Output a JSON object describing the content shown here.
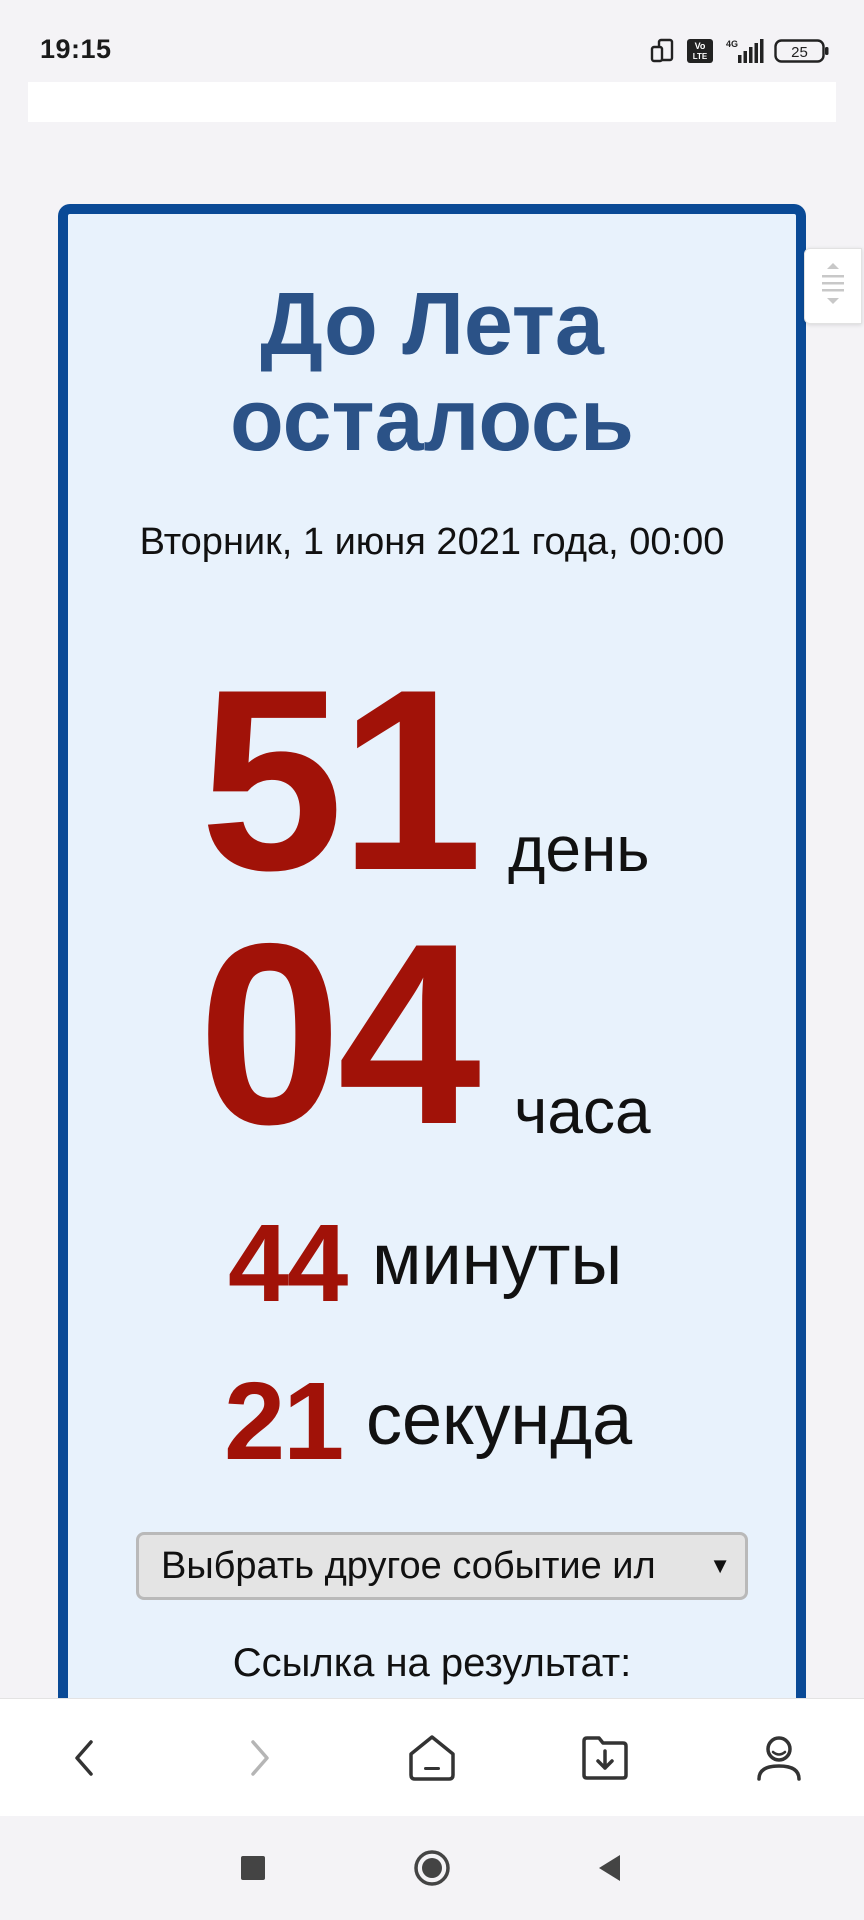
{
  "status_bar": {
    "time": "19:15",
    "network": "4G",
    "volte": "Vo LTE",
    "battery": "25",
    "icons": [
      "screen-rotate-icon",
      "volte-icon",
      "signal-icon",
      "battery-icon"
    ]
  },
  "countdown": {
    "title": "До Лета осталось",
    "date": "Вторник, 1 июня 2021 года, 00:00",
    "days_value": "51",
    "days_unit": "день",
    "hours_value": "04",
    "hours_unit": "часа",
    "minutes_value": "44",
    "minutes_unit": "минуты",
    "seconds_value": "21",
    "seconds_unit": "секунда",
    "select_label": "Выбрать другое событие ил",
    "result_link_label": "Ссылка на результат:"
  },
  "browser_toolbar": {
    "icons": [
      "back-icon",
      "forward-icon",
      "home-icon",
      "downloads-icon",
      "profile-icon"
    ]
  },
  "android_nav": {
    "icons": [
      "recents-icon",
      "home-circle-icon",
      "back-triangle-icon"
    ]
  },
  "colors": {
    "accent_border": "#0a4a96",
    "title": "#2b5287",
    "numbers": "#a11208",
    "panel_bg": "#e8f2fc"
  }
}
